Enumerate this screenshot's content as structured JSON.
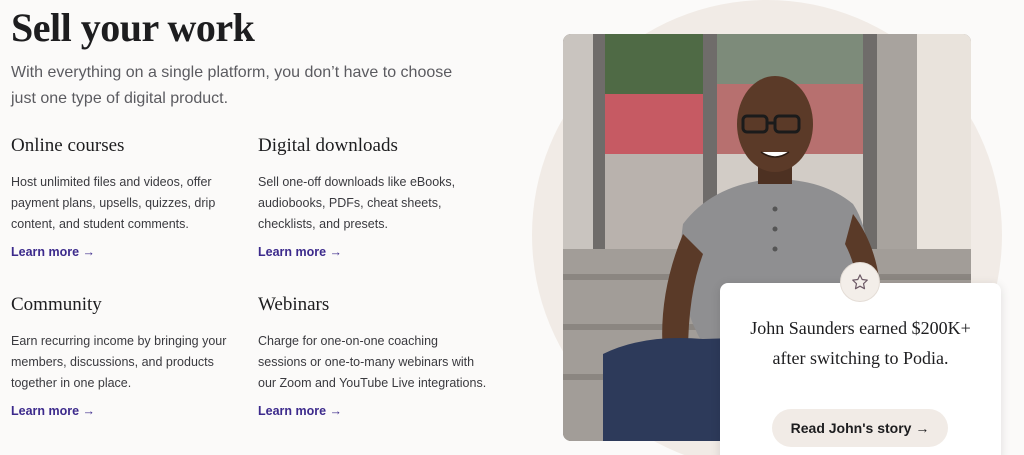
{
  "hero": {
    "title": "Sell your work",
    "subtitle": "With everything on a single platform, you don’t have to choose just one type of digital product."
  },
  "features": [
    {
      "title": "Online courses",
      "description": "Host unlimited files and videos, offer payment plans, upsells, quizzes, drip content, and student comments.",
      "link": "Learn more →"
    },
    {
      "title": "Digital downloads",
      "description": "Sell one-off downloads like eBooks, audiobooks, PDFs, cheat sheets, checklists, and presets.",
      "link": "Learn more →"
    },
    {
      "title": "Community",
      "description": "Earn recurring income by bringing your members, discussions, and products together in one place.",
      "link": "Learn more →"
    },
    {
      "title": "Webinars",
      "description": "Charge for one-on-one coaching sessions or one-to-many webinars with our Zoom and YouTube Live integrations.",
      "link": "Learn more →"
    }
  ],
  "testimonial": {
    "quote": "John Saunders earned $200K+ after switching to Podia.",
    "button": "Read John's story →",
    "badge_icon": "star-icon"
  },
  "colors": {
    "link": "#3c2a8c",
    "background": "#fbfaf9",
    "accent_circle": "#f1ebe6"
  }
}
